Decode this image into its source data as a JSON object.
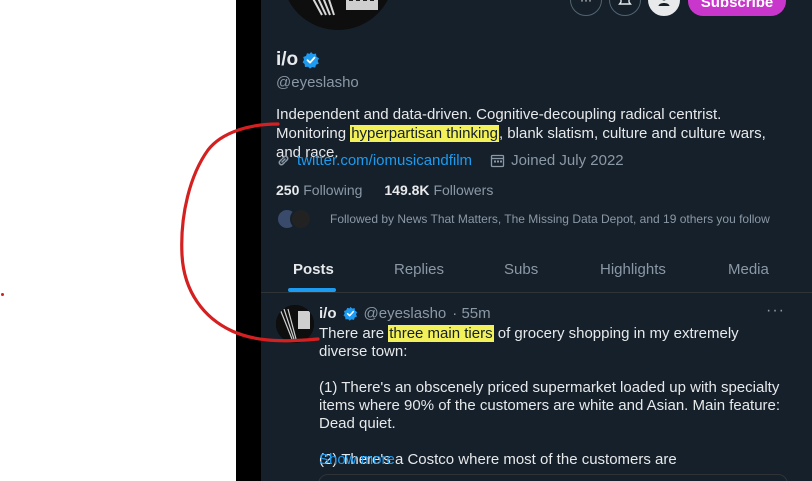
{
  "profile": {
    "name": "i/o",
    "handle": "@eyeslasho",
    "bio_before": "Independent and data-driven. Cognitive-decoupling radical centrist. Monitoring ",
    "bio_highlight": "hyperpartisan thinking",
    "bio_after": ", blank slatism, culture and culture wars, and race.",
    "website": "twitter.com/iomusicandfilm",
    "joined": "Joined July 2022",
    "following_count": "250",
    "following_label": "Following",
    "followers_count": "149.8K",
    "followers_label": "Followers",
    "followed_by": "Followed by News That Matters, The Missing Data Depot, and 19 others you follow",
    "subscribe_label": "Subscribe"
  },
  "tabs": [
    {
      "label": "Posts",
      "active": true
    },
    {
      "label": "Replies",
      "active": false
    },
    {
      "label": "Subs",
      "active": false
    },
    {
      "label": "Highlights",
      "active": false
    },
    {
      "label": "Media",
      "active": false
    }
  ],
  "post": {
    "name": "i/o",
    "handle": "@eyeslasho",
    "time": "· 55m",
    "line1_before": "There are ",
    "line1_highlight": "three main tiers",
    "line1_after": " of grocery shopping in my extremely diverse town:",
    "para2": "(1) There's an obscenely priced supermarket loaded up with specialty items where 90% of the customers are white and Asian. Main feature: Dead quiet.",
    "para3": "(2) There's a Costco where most of the customers are",
    "show_more": "Show more",
    "more_icon": "···"
  },
  "colors": {
    "accent": "#1d9bf0",
    "subscribe": "#c936cc",
    "highlight": "#f3f15a",
    "annotation": "#d42020"
  }
}
